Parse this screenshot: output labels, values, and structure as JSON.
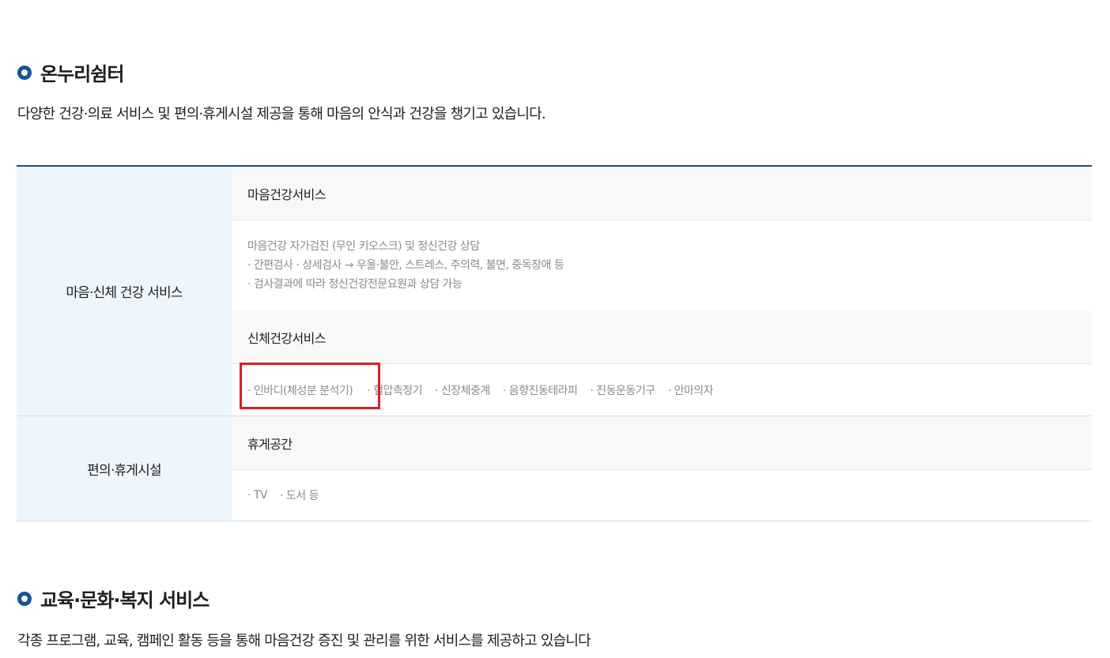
{
  "section1": {
    "title": "온누리쉼터",
    "description": "다양한 건강·의료 서비스 및 편의·휴게시설 제공을 통해 마음의 안식과 건강을 챙기고 있습니다."
  },
  "table": {
    "groups": [
      {
        "head": "마음·신체 건강 서비스",
        "subs": [
          {
            "title": "마음건강서비스",
            "lines": [
              "마음건강 자가검진 (무인 키오스크) 및 정신건강 상담",
              "· 간편검사    · 상세검사    → 우울·불안, 스트레스, 주의력, 불면, 중독장애 등",
              "· 검사결과에 따라 정신건강전문요원과 상담 가능"
            ]
          },
          {
            "title": "신체건강서비스",
            "items": [
              "· 인바디(체성분 분석기)",
              "· 혈압측정기",
              "· 신장체중계",
              "· 음향진동테라피",
              "· 진동운동기구",
              "· 안마의자"
            ]
          }
        ]
      },
      {
        "head": "편의·휴게시설",
        "subs": [
          {
            "title": "휴게공간",
            "items": [
              "· TV",
              "· 도서 등"
            ]
          }
        ]
      }
    ]
  },
  "section2": {
    "title": "교육·문화·복지 서비스",
    "description": "각종 프로그램, 교육, 캠페인 활동 등을 통해 마음건강 증진 및 관리를 위한 서비스를 제공하고 있습니다"
  },
  "colors": {
    "accent": "#15529a",
    "table_border": "#1a4f84",
    "head_bg": "#eef6fd",
    "highlight": "#d81f26"
  }
}
